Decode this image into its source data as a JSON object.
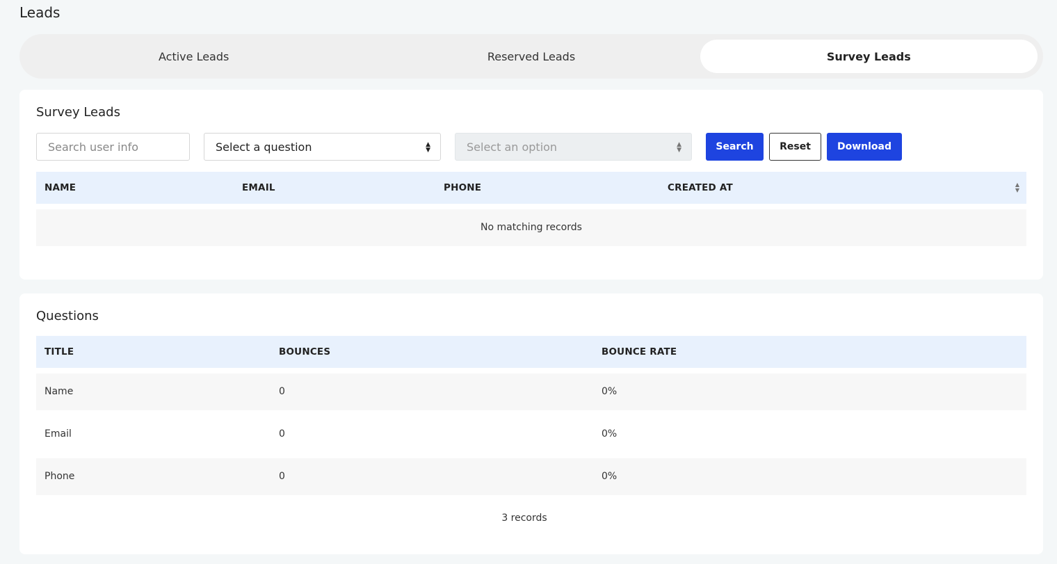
{
  "page": {
    "title": "Leads"
  },
  "tabs": [
    {
      "label": "Active Leads",
      "active": false
    },
    {
      "label": "Reserved Leads",
      "active": false
    },
    {
      "label": "Survey Leads",
      "active": true
    }
  ],
  "survey": {
    "title": "Survey Leads",
    "search": {
      "placeholder": "Search user info",
      "value": ""
    },
    "question_select": {
      "value": "Select a question"
    },
    "option_select": {
      "value": "Select an option",
      "disabled": true
    },
    "buttons": {
      "search": "Search",
      "reset": "Reset",
      "download": "Download"
    },
    "columns": [
      "NAME",
      "EMAIL",
      "PHONE",
      "CREATED AT"
    ],
    "empty_message": "No matching records"
  },
  "questions": {
    "title": "Questions",
    "columns": [
      "TITLE",
      "BOUNCES",
      "BOUNCE RATE"
    ],
    "rows": [
      {
        "title": "Name",
        "bounces": "0",
        "bounce_rate": "0%"
      },
      {
        "title": "Email",
        "bounces": "0",
        "bounce_rate": "0%"
      },
      {
        "title": "Phone",
        "bounces": "0",
        "bounce_rate": "0%"
      }
    ],
    "records": "3 records"
  },
  "colors": {
    "primary": "#1e44e0",
    "header_bg": "#e8f1fd",
    "page_bg": "#f4f7f8"
  }
}
